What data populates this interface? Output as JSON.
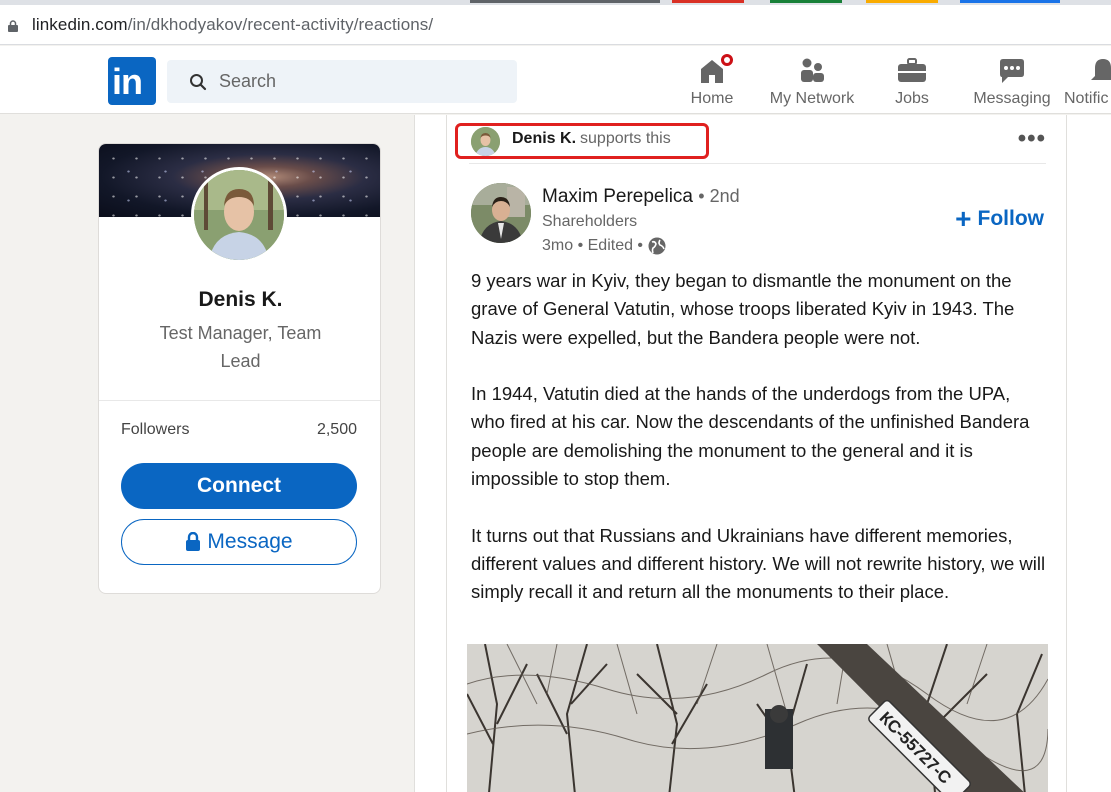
{
  "browser": {
    "url_host": "linkedin.com",
    "url_path": "/in/dkhodyakov/recent-activity/reactions/"
  },
  "nav": {
    "logo": "in",
    "search_placeholder": "Search",
    "items": [
      {
        "label": "Home",
        "icon": "home-icon"
      },
      {
        "label": "My Network",
        "icon": "network-icon"
      },
      {
        "label": "Jobs",
        "icon": "jobs-icon"
      },
      {
        "label": "Messaging",
        "icon": "messaging-icon"
      },
      {
        "label": "Notific",
        "icon": "bell-icon"
      }
    ],
    "brand_color": "#0a66c2"
  },
  "profile": {
    "name": "Denis K.",
    "headline": "Test Manager, Team Lead",
    "followers_label": "Followers",
    "followers_count": "2,500",
    "connect_label": "Connect",
    "message_label": "Message"
  },
  "post": {
    "activity_actor": "Denis K.",
    "activity_action": "supports this",
    "more_icon": "more-icon",
    "author_name": "Maxim Perepelica",
    "author_degree": "• 2nd",
    "author_subtitle": "Shareholders",
    "meta_time": "3mo • Edited •",
    "follow_label": "Follow",
    "paragraphs": [
      "9 years war in Kyiv, they began to dismantle the monument on the grave of General Vatutin, whose troops liberated Kyiv in 1943. The Nazis were expelled, but the Bandera people were not.",
      "In 1944, Vatutin died at the hands of the underdogs from the UPA, who fired at his car. Now the descendants of the unfinished Bandera people are demolishing the monument to the general and it is impossible to stop them.",
      "It turns out that Russians and Ukrainians have different memories, different values and different history. We will not rewrite history, we will simply recall it and return all the monuments to their place."
    ],
    "image_plate_text": "КС-55727-С"
  }
}
